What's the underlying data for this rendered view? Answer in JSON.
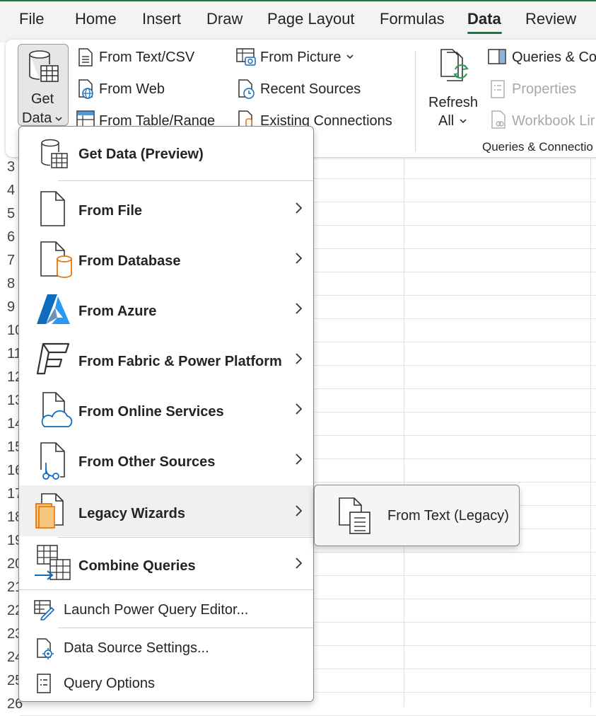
{
  "menu": {
    "tabs": [
      {
        "label": "File"
      },
      {
        "label": "Home"
      },
      {
        "label": "Insert"
      },
      {
        "label": "Draw"
      },
      {
        "label": "Page Layout"
      },
      {
        "label": "Formulas"
      },
      {
        "label": "Data",
        "active": true
      },
      {
        "label": "Review"
      }
    ],
    "accent_color": "#107c41"
  },
  "ribbon": {
    "get_data": {
      "line1": "Get",
      "line2": "Data"
    },
    "col1": [
      "From Text/CSV",
      "From Web",
      "From Table/Range"
    ],
    "col2": [
      "From Picture",
      "Recent Sources",
      "Existing Connections"
    ],
    "refresh": {
      "line1": "Refresh",
      "line2": "All"
    },
    "col3": [
      {
        "label": "Queries & Co",
        "disabled": false
      },
      {
        "label": "Properties",
        "disabled": true
      },
      {
        "label": "Workbook Lir",
        "disabled": true
      }
    ],
    "group_label": "Queries & Connectio"
  },
  "sheet": {
    "row_numbers": [
      "3",
      "4",
      "5",
      "6",
      "7",
      "8",
      "9",
      "10",
      "11",
      "12",
      "13",
      "14",
      "15",
      "16",
      "17",
      "18",
      "19",
      "20",
      "21",
      "22",
      "23",
      "24",
      "25",
      "26"
    ]
  },
  "dropdown": {
    "header": "Get Data (Preview)",
    "items": [
      {
        "label": "From File",
        "icon": "file-icon"
      },
      {
        "label": "From Database",
        "icon": "database-icon"
      },
      {
        "label": "From Azure",
        "icon": "azure-icon"
      },
      {
        "label": "From Fabric & Power Platform",
        "icon": "fabric-icon"
      },
      {
        "label": "From Online Services",
        "icon": "cloud-icon"
      },
      {
        "label": "From Other Sources",
        "icon": "other-sources-icon"
      },
      {
        "label": "Legacy Wizards",
        "icon": "legacy-icon"
      },
      {
        "label": "Combine Queries",
        "icon": "combine-icon"
      }
    ],
    "actions": [
      {
        "label": "Launch Power Query Editor...",
        "icon": "query-editor-icon"
      },
      {
        "label": "Data Source Settings...",
        "icon": "settings-icon"
      },
      {
        "label": "Query Options",
        "icon": "options-icon"
      }
    ],
    "accent_orange": "#e8740c",
    "accent_blue": "#0f6cbd"
  },
  "submenu": {
    "items": [
      {
        "label": "From Text (Legacy)",
        "icon": "text-file-icon"
      }
    ]
  }
}
